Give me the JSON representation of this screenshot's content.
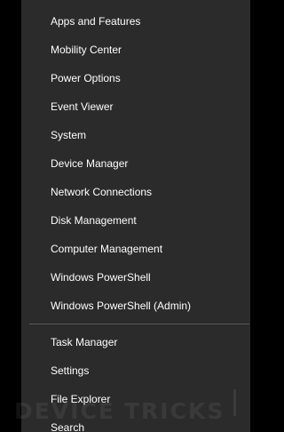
{
  "menu": {
    "items": [
      {
        "label": "Apps and Features"
      },
      {
        "label": "Mobility Center"
      },
      {
        "label": "Power Options"
      },
      {
        "label": "Event Viewer"
      },
      {
        "label": "System"
      },
      {
        "label": "Device Manager"
      },
      {
        "label": "Network Connections"
      },
      {
        "label": "Disk Management"
      },
      {
        "label": "Computer Management"
      },
      {
        "label": "Windows PowerShell"
      },
      {
        "label": "Windows PowerShell (Admin)"
      },
      {
        "label": "Task Manager"
      },
      {
        "label": "Settings"
      },
      {
        "label": "File Explorer"
      },
      {
        "label": "Search"
      }
    ]
  },
  "watermark": {
    "left": "DEVICE",
    "right": "TRICKS"
  },
  "colors": {
    "menu_background": "#2b2b2b",
    "text": "#ffffff",
    "divider": "#5a5a5a",
    "outside": "#000000"
  }
}
